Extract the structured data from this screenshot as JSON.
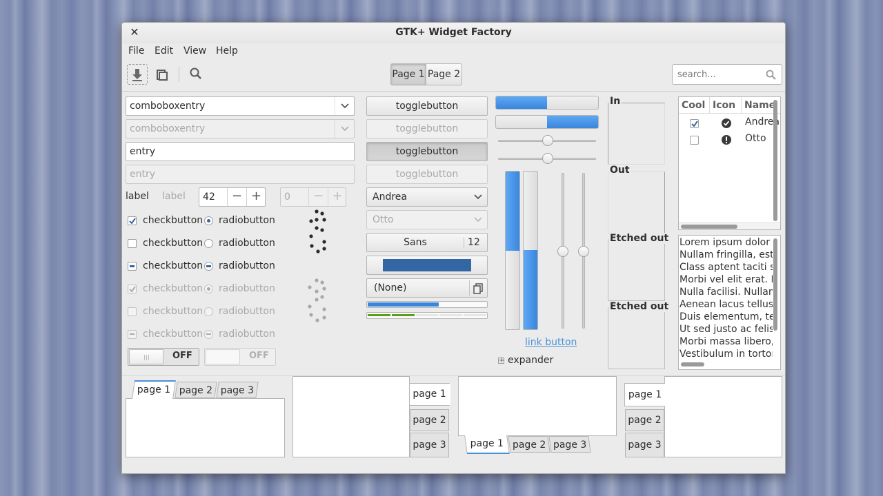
{
  "window": {
    "title": "GTK+ Widget Factory"
  },
  "menu": {
    "items": [
      "File",
      "Edit",
      "View",
      "Help"
    ]
  },
  "toolbar": {
    "buttons": [
      "download-icon",
      "copy-icon",
      "search-icon"
    ],
    "page_switcher": [
      "Page 1",
      "Page 2"
    ],
    "active_page": "Page 1",
    "search_placeholder": "search..."
  },
  "column1": {
    "combo1": "comboboxentry",
    "combo2": "comboboxentry",
    "entry1": "entry",
    "entry2_placeholder": "entry",
    "label1": "label",
    "label2": "label",
    "spin1_value": "42",
    "spin2_value": "0",
    "checks": [
      {
        "label": "checkbutton",
        "state": "checked"
      },
      {
        "label": "checkbutton",
        "state": "unchecked"
      },
      {
        "label": "checkbutton",
        "state": "inconsistent"
      },
      {
        "label": "checkbutton",
        "state": "checked-disabled"
      },
      {
        "label": "checkbutton",
        "state": "unchecked-disabled"
      },
      {
        "label": "checkbutton",
        "state": "inconsistent-disabled"
      }
    ],
    "radios": [
      {
        "label": "radiobutton",
        "state": "selected"
      },
      {
        "label": "radiobutton",
        "state": "unselected"
      },
      {
        "label": "radiobutton",
        "state": "inconsistent"
      },
      {
        "label": "radiobutton",
        "state": "selected-disabled"
      },
      {
        "label": "radiobutton",
        "state": "unselected-disabled"
      },
      {
        "label": "radiobutton",
        "state": "inconsistent-disabled"
      }
    ],
    "switch1_label": "OFF",
    "switch2_label": "OFF"
  },
  "column2": {
    "toggles": [
      "togglebutton",
      "togglebutton",
      "togglebutton",
      "togglebutton"
    ],
    "combo_selected": "Andrea",
    "combo_disabled": "Otto",
    "font_name": "Sans",
    "font_size": "12",
    "file_chooser": "(None)",
    "progress_value": 0.6,
    "level_value": 0.4
  },
  "column3": {
    "hprogress1": 0.5,
    "hprogress2": 0.5,
    "hscale1": 0.5,
    "hscale2": 0.5,
    "vprogress1": 0.5,
    "vprogress2": 0.5,
    "vscale1": 0.5,
    "vscale2": 0.5,
    "link": "link button",
    "expander": "expander"
  },
  "frames": [
    "In",
    "Out",
    "Etched out",
    "Etched out"
  ],
  "treeview": {
    "columns": [
      "Cool",
      "Icon",
      "Name"
    ],
    "rows": [
      {
        "cool": true,
        "icon": "checkmark-icon",
        "name": "Andrea"
      },
      {
        "cool": false,
        "icon": "warning-icon",
        "name": "Otto"
      }
    ]
  },
  "textview": {
    "lines": [
      "Lorem ipsum dolor sit",
      "Nullam fringilla, est",
      "Class aptent taciti so",
      "Morbi vel elit erat. M",
      "Nulla facilisi. Nullam",
      "Aenean lacus tellus, t",
      "Duis elementum, tell",
      "Ut sed justo ac felis",
      "Morbi massa libero,",
      "Vestibulum in tortor"
    ]
  },
  "notebooks": {
    "nb1": [
      "page 1",
      "page 2",
      "page 3"
    ],
    "nb2": [
      "page 1",
      "page 2",
      "page 3"
    ],
    "nb3": [
      "page 1",
      "page 2",
      "page 3"
    ],
    "nb4": [
      "page 1",
      "page 2",
      "page 3"
    ]
  },
  "colors": {
    "accent": "#4a90d9",
    "accent_dark": "#3465a4",
    "level_green": "#5a9e1a"
  }
}
